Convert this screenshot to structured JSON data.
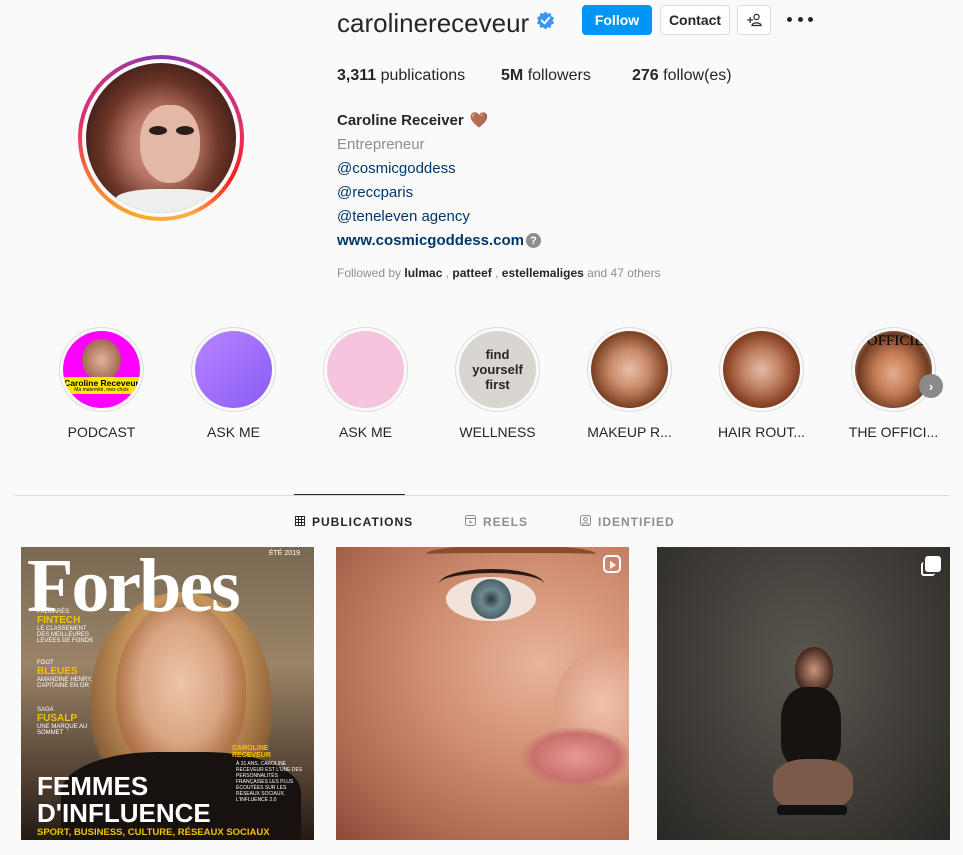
{
  "profile": {
    "username": "carolinereceveur",
    "follow_label": "Follow",
    "contact_label": "Contact",
    "suggest_label": "+⚇",
    "stats": {
      "posts_count": "3,311",
      "posts_label": "publications",
      "followers_count": "5M",
      "followers_label": "followers",
      "following_count": "276",
      "following_label": "follow(es)"
    },
    "full_name": "Caroline Receiver",
    "name_emoji": "🤎",
    "category": "Entrepreneur",
    "bio_lines": [
      "@cosmicgoddess",
      "@reccparis",
      "@teneleven agency"
    ],
    "website": "www.cosmicgoddess.com",
    "followed_by": {
      "prefix": "Followed by",
      "names": [
        "lulmac",
        "patteef",
        "estellemaliges"
      ],
      "suffix": "and 47 others"
    }
  },
  "highlights": [
    {
      "label": "PODCAST",
      "cover_title": "Caroline Receveur",
      "cover_sub": "Ma maternité, mes choix"
    },
    {
      "label": "ASK ME"
    },
    {
      "label": "ASK ME"
    },
    {
      "label": "WELLNESS",
      "cover_text": "find yourself first"
    },
    {
      "label": "MAKEUP R..."
    },
    {
      "label": "HAIR ROUT..."
    },
    {
      "label": "THE OFFICI...",
      "cover_text": "L'OFFICIEL"
    }
  ],
  "tabs": [
    {
      "label": "PUBLICATIONS",
      "icon": "grid-icon",
      "active": true
    },
    {
      "label": "REELS",
      "icon": "reels-icon",
      "active": false
    },
    {
      "label": "IDENTIFIED",
      "icon": "tagged-icon",
      "active": false
    }
  ],
  "posts": {
    "forbes": {
      "masthead": "Forbes",
      "date": "ÉTÉ 2019",
      "side1_kicker": "PALMARÈS",
      "side1_key": "FINTECH",
      "side1_text": "LE CLASSEMENT DES MEILLEURES LEVÉES DE FONDS",
      "side2_kicker": "FOOT",
      "side2_key": "BLEUES",
      "side2_text": "AMANDINE HENRY, CAPITAINE EN OR",
      "side3_kicker": "SAGA",
      "side3_key": "FUSALP",
      "side3_text": "UNE MARQUE AU SOMMET",
      "cover_name": "CAROLINE RECEVEUR",
      "cover_blurb": "À 31 ANS, CAROLINE RECEVEUR EST L'UNE DES PERSONNALITÉS FRANÇAISES LES PLUS ÉCOUTÉES SUR LES RÉSEAUX SOCIAUX. L'INFLUENCE 2.0",
      "headline_1": "FEMMES",
      "headline_2": "D'INFLUENCE",
      "subline": "SPORT, BUSINESS, CULTURE, RÉSEAUX SOCIAUX"
    }
  },
  "colors": {
    "primary_button": "#0095f6",
    "link": "#00376b",
    "muted": "#8e8e8e",
    "verified": "#3897f0"
  }
}
